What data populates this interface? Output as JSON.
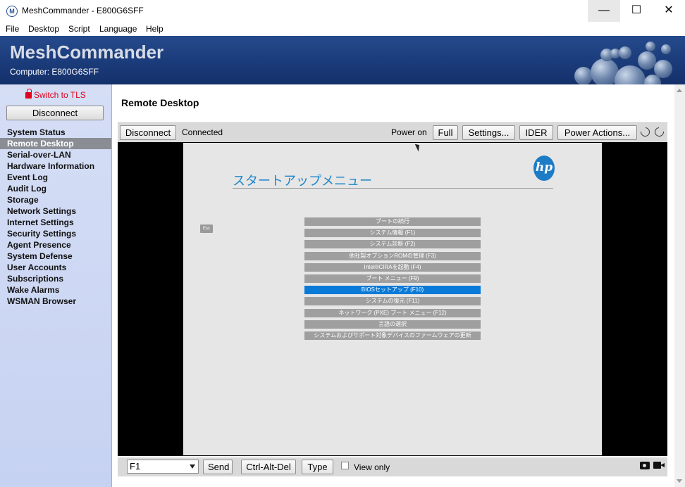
{
  "window": {
    "title": "MeshCommander - E800G6SFF",
    "minimize": "—",
    "maximize": "☐",
    "close": "✕"
  },
  "menu": [
    "File",
    "Desktop",
    "Script",
    "Language",
    "Help"
  ],
  "header": {
    "brand": "MeshCommander",
    "computer": "Computer: E800G6SFF"
  },
  "sidebar": {
    "tls_link": "Switch to TLS",
    "disconnect": "Disconnect",
    "items": [
      "System Status",
      "Remote Desktop",
      "Serial-over-LAN",
      "Hardware Information",
      "Event Log",
      "Audit Log",
      "Storage",
      "Network Settings",
      "Internet Settings",
      "Security Settings",
      "Agent Presence",
      "System Defense",
      "User Accounts",
      "Subscriptions",
      "Wake Alarms",
      "WSMAN Browser"
    ],
    "active_index": 1
  },
  "main": {
    "title": "Remote Desktop"
  },
  "toolbar": {
    "disconnect": "Disconnect",
    "status": "Connected",
    "power_status": "Power on",
    "full": "Full",
    "settings": "Settings...",
    "ider": "IDER",
    "power_actions": "Power Actions..."
  },
  "bios": {
    "title": "スタートアップメニュー",
    "logo": "hp",
    "esc": "Esc",
    "items": [
      "ブートの続行",
      "システム情報 (F1)",
      "システム診断 (F2)",
      "他社製オプションROMの管理 (F3)",
      "Intel®CIRAを起動 (F4)",
      "ブート メニュー (F9)",
      "BIOSセットアップ (F10)",
      "システムの復元 (F11)",
      "ネットワーク (PXE) ブート メニュー (F12)",
      "言語の選択",
      "システムおよびサポート対象デバイスのファームウェアの更新"
    ],
    "selected_index": 6
  },
  "bottombar": {
    "key_select": "F1",
    "send": "Send",
    "ctrl_alt_del": "Ctrl-Alt-Del",
    "type": "Type",
    "view_only": "View only"
  }
}
